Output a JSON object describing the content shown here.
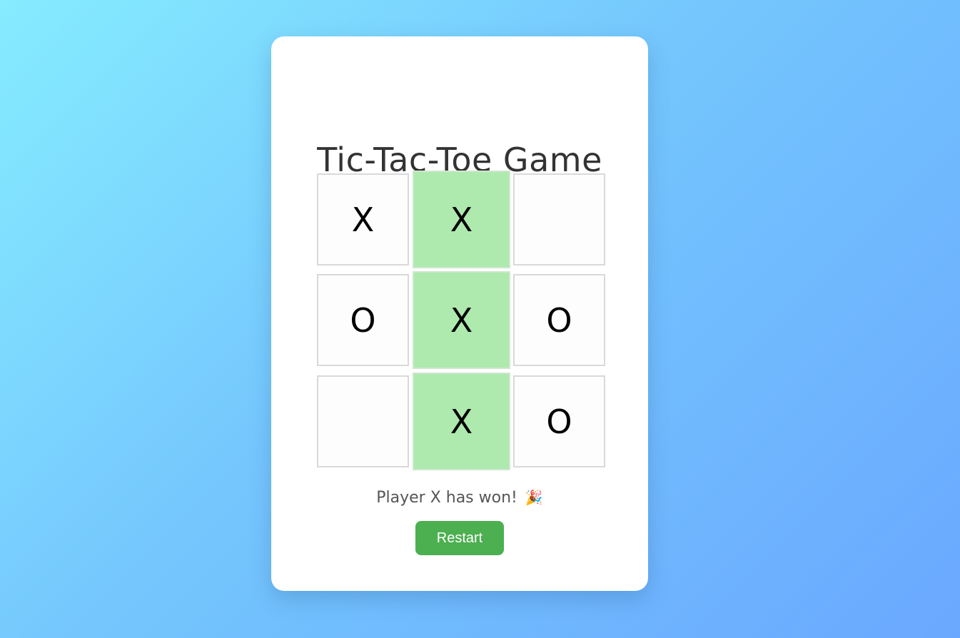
{
  "game": {
    "title": "Tic-Tac-Toe Game",
    "status": "Player X has won!",
    "status_emoji": "🎉",
    "restart_label": "Restart",
    "board": [
      "X",
      "X",
      "",
      "O",
      "X",
      "O",
      "",
      "X",
      "O"
    ],
    "winning_cells": [
      1,
      4,
      7
    ]
  },
  "colors": {
    "background_start": "#86ecff",
    "background_end": "#6aa8ff",
    "card": "#ffffff",
    "win_highlight": "#aeeaae",
    "restart_button": "#4caf50",
    "title_text": "#333333"
  }
}
